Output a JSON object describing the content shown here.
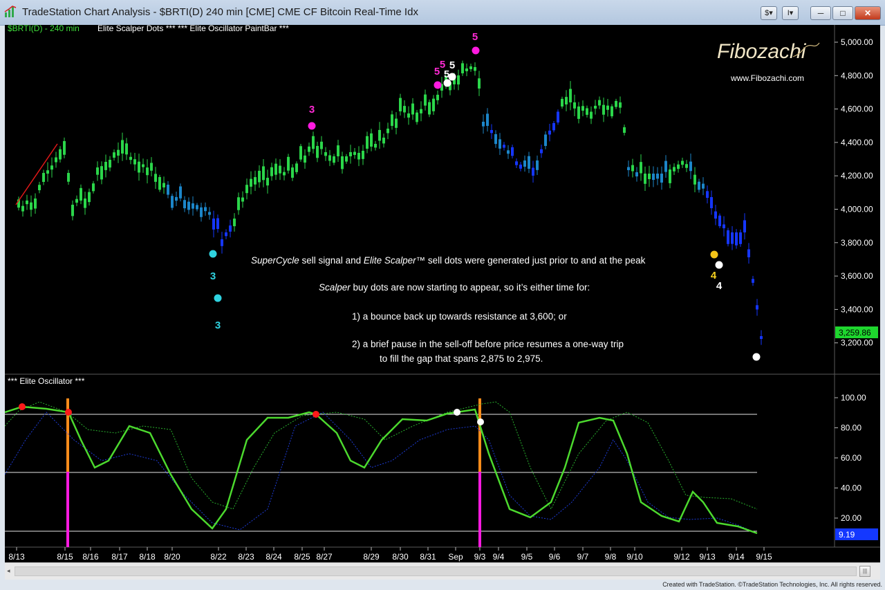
{
  "window": {
    "title": "TradeStation Chart Analysis - $BRTI(D) 240 min [CME] CME CF Bitcoin Real-Time Idx",
    "buttons": [
      "$",
      "I"
    ],
    "controls": {
      "minimize": "─",
      "maximize": "□",
      "close": "✕"
    },
    "app_icon": "tradestation-chart-icon"
  },
  "chart": {
    "symbol_label": "$BRTI(D) - 240 min",
    "indicators_label": "Elite Scalper Dots ***  *** Elite Oscillator PaintBar ***",
    "last_price": "3,259.86",
    "price_ticks": [
      "5,000.00",
      "4,800.00",
      "4,600.00",
      "4,400.00",
      "4,200.00",
      "4,000.00",
      "3,800.00",
      "3,600.00",
      "3,400.00",
      "3,200.00"
    ],
    "logo_text": "Fibozachi",
    "logo_url": "www.Fibozachi.com",
    "annotations": [
      {
        "parts": [
          {
            "t": "SuperCycle",
            "i": true
          },
          {
            "t": " sell signal and ",
            "i": false
          },
          {
            "t": "Elite Scalper™",
            "i": true
          },
          {
            "t": " sell dots were generated just prior to and at the peak",
            "i": false
          }
        ]
      },
      {
        "parts": [
          {
            "t": "Scalper",
            "i": true
          },
          {
            "t": " buy dots are now starting to appear, so it’s either time for:",
            "i": false
          }
        ]
      },
      {
        "parts": [
          {
            "t": "1) a bounce back up towards resistance at 3,600; or",
            "i": false
          }
        ]
      },
      {
        "parts": [
          {
            "t": "2) a brief pause in the sell-off before price resumes a one-way trip",
            "i": false
          }
        ]
      },
      {
        "parts": [
          {
            "t": "to fill the gap that spans 2,875 to 2,975.",
            "i": false
          }
        ]
      }
    ],
    "wave_labels": [
      {
        "t": "3",
        "c": "#2fd3e0"
      },
      {
        "t": "3",
        "c": "#2fd3e0"
      },
      {
        "t": "3",
        "c": "#ff2ad4"
      },
      {
        "t": "5",
        "c": "#ff2ad4"
      },
      {
        "t": "5",
        "c": "#ff2ad4"
      },
      {
        "t": "5",
        "c": "#ffffff"
      },
      {
        "t": "5",
        "c": "#ffffff"
      },
      {
        "t": "5",
        "c": "#ff2ad4"
      },
      {
        "t": "4",
        "c": "#f5d020"
      },
      {
        "t": "4",
        "c": "#ffffff"
      }
    ]
  },
  "oscillator": {
    "label": "*** Elite Oscillator ***",
    "ticks": [
      "100.00",
      "80.00",
      "60.00",
      "40.00",
      "20.00"
    ],
    "last_value": "9.19"
  },
  "x_axis": {
    "dates": [
      "8/13",
      "8/15",
      "8/16",
      "8/17",
      "8/18",
      "8/20",
      "8/22",
      "8/23",
      "8/24",
      "8/25",
      "8/27",
      "8/29",
      "8/30",
      "8/31",
      "Sep",
      "9/3",
      "9/4",
      "9/5",
      "9/6",
      "9/7",
      "9/8",
      "9/10",
      "9/12",
      "9/13",
      "9/14",
      "9/15"
    ]
  },
  "footer": {
    "credit": "Created with TradeStation. ©TradeStation Technologies, Inc. All rights reserved."
  },
  "colors": {
    "background": "#000000",
    "up_candle": "#2bd64a",
    "down_candle": "#1536ff",
    "transition_candle": "#1c86c9",
    "oscillator_line": "#4cd92e",
    "signal_line": "#29b32e",
    "orange_marker": "#ff8c1a",
    "magenta_marker": "#ff1ae0",
    "text": "#ffffff"
  }
}
